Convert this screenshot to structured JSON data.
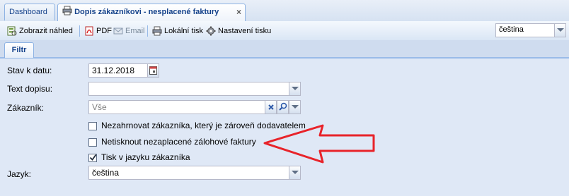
{
  "tabs": {
    "dashboard": "Dashboard",
    "active": "Dopis zákazníkovi - nesplacené faktury",
    "close": "×"
  },
  "toolbar": {
    "preview": "Zobrazit náhled",
    "pdf": "PDF",
    "email": "Email",
    "local_print": "Lokální tisk",
    "print_settings": "Nastavení tisku",
    "language_value": "čeština"
  },
  "filter_tab": "Filtr",
  "form": {
    "stav_label": "Stav k datu:",
    "stav_value": "31.12.2018",
    "text_label": "Text dopisu:",
    "text_value": "",
    "zakaznik_label": "Zákazník:",
    "zakaznik_placeholder": "Vše",
    "cb1_label": "Nezahrnovat zákazníka, který je zároveň dodavatelem",
    "cb1_checked": false,
    "cb2_label": "Netisknout nezaplacené zálohové faktury",
    "cb2_checked": false,
    "cb3_label": "Tisk v jazyku zákazníka",
    "cb3_checked": true,
    "jazyk_label": "Jazyk:",
    "jazyk_value": "čeština"
  },
  "colors": {
    "annotation_arrow": "#e8232a",
    "tab_text": "#15428b"
  }
}
